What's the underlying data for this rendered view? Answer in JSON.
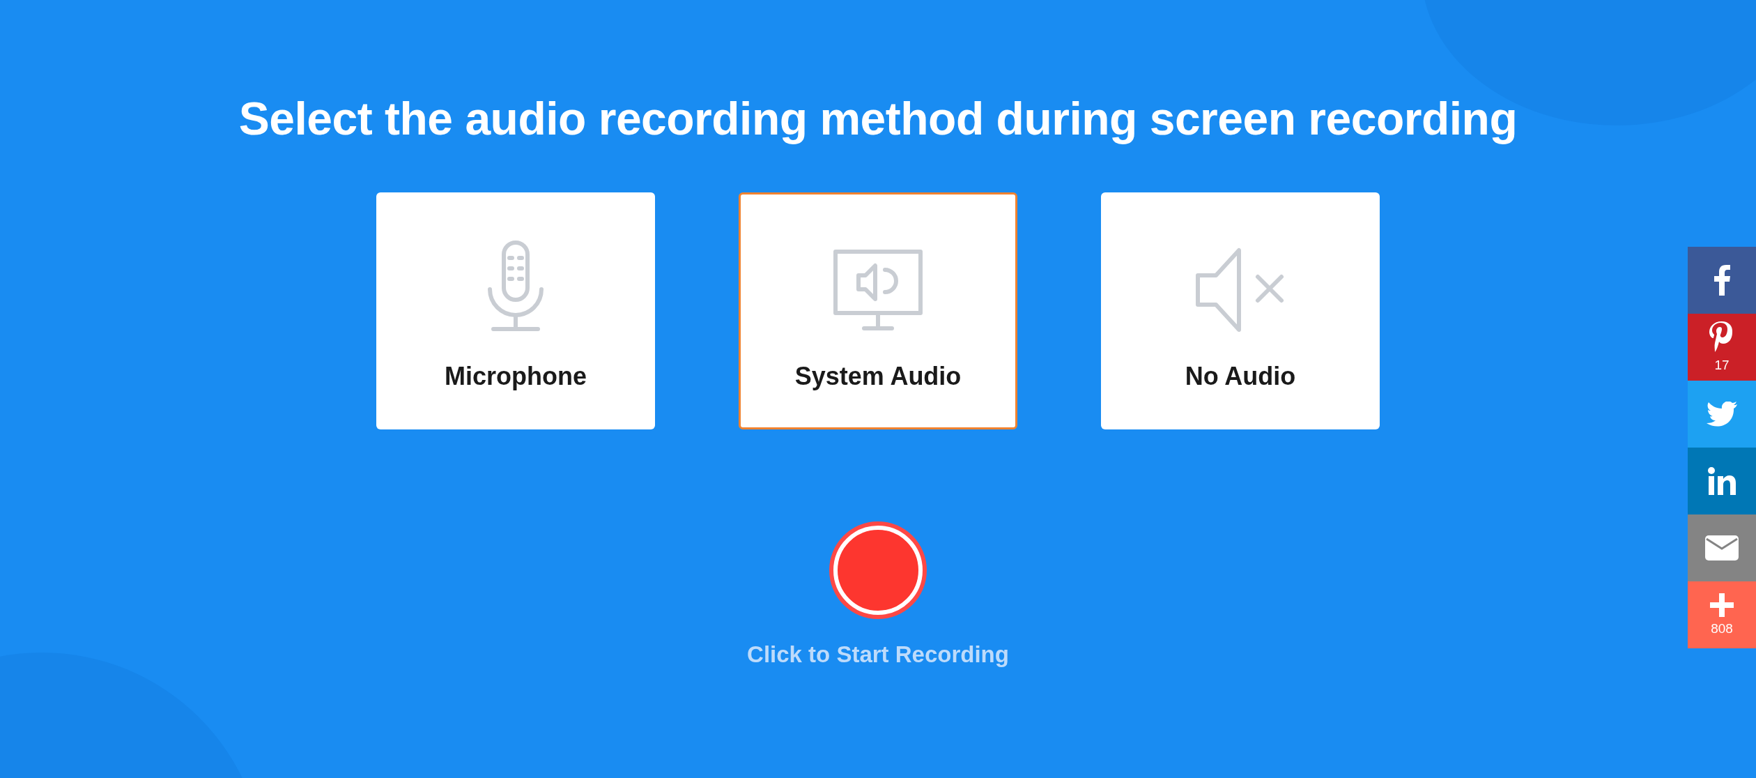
{
  "title": "Select the audio recording method during screen recording",
  "options": [
    {
      "kind": "microphone",
      "label": "Microphone",
      "selected": false
    },
    {
      "kind": "system",
      "label": "System Audio",
      "selected": true
    },
    {
      "kind": "none",
      "label": "No Audio",
      "selected": false
    }
  ],
  "record": {
    "label": "Click to Start Recording"
  },
  "share": [
    {
      "kind": "facebook",
      "color": "#3b5998"
    },
    {
      "kind": "pinterest",
      "color": "#cb2027",
      "count": "17"
    },
    {
      "kind": "twitter",
      "color": "#1da1f2"
    },
    {
      "kind": "linkedin",
      "color": "#0077b5"
    },
    {
      "kind": "email",
      "color": "#848484"
    },
    {
      "kind": "more",
      "color": "#ff6550",
      "count": "808"
    }
  ]
}
